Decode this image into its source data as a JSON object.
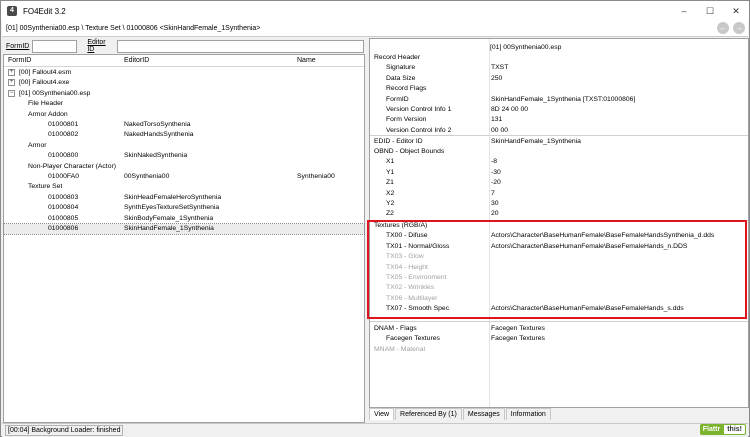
{
  "window": {
    "app_icon": "4",
    "title": "FO4Edit 3.2",
    "minimize": "–",
    "maximize": "☐",
    "close": "✕"
  },
  "path": {
    "text": "[01] 00Synthenia00.esp \\ Texture Set \\ 01000806 <SkinHandFemale_1Synthenia>",
    "back_icon": "←",
    "forward_icon": "→"
  },
  "filter": {
    "formid_label": "FormID",
    "editorid_label": "Editor ID",
    "formid_value": "",
    "editorid_value": ""
  },
  "tree": {
    "columns": [
      "FormID",
      "EditorID",
      "Name"
    ],
    "rows": [
      {
        "exp": "+",
        "formid": "[00] Fallout4.esm",
        "editorid": "",
        "name": ""
      },
      {
        "exp": "+",
        "formid": "[00] Fallout4.exe",
        "editorid": "",
        "name": ""
      },
      {
        "exp": "−",
        "formid": "[01] 00Synthenia00.esp",
        "editorid": "",
        "name": ""
      },
      {
        "exp": "",
        "formid": "File Header",
        "editorid": "",
        "name": ""
      },
      {
        "exp": "",
        "formid": "Armor Addon",
        "editorid": "",
        "name": ""
      },
      {
        "exp": "",
        "formid": "01000801",
        "editorid": "NakedTorsoSynthenia",
        "name": ""
      },
      {
        "exp": "",
        "formid": "01000802",
        "editorid": "NakedHandsSynthenia",
        "name": ""
      },
      {
        "exp": "",
        "formid": "Armor",
        "editorid": "",
        "name": ""
      },
      {
        "exp": "",
        "formid": "01000800",
        "editorid": "SkinNakedSynthenia",
        "name": ""
      },
      {
        "exp": "",
        "formid": "Non-Player Character (Actor)",
        "editorid": "",
        "name": ""
      },
      {
        "exp": "",
        "formid": "01000FA0",
        "editorid": "00Synthenia00",
        "name": "Synthenia00"
      },
      {
        "exp": "",
        "formid": "Texture Set",
        "editorid": "",
        "name": ""
      },
      {
        "exp": "",
        "formid": "01000803",
        "editorid": "SkinHeadFemaleHeroSynthenia",
        "name": ""
      },
      {
        "exp": "",
        "formid": "01000804",
        "editorid": "SynthEyesTextureSetSynthenia",
        "name": ""
      },
      {
        "exp": "",
        "formid": "01000805",
        "editorid": "SkinBodyFemale_1Synthenia",
        "name": ""
      },
      {
        "exp": "",
        "formid": "01000806",
        "editorid": "SkinHandFemale_1Synthenia",
        "name": ""
      }
    ]
  },
  "record": {
    "header": "[01] 00Synthenia00.esp",
    "rows": [
      {
        "label": "Record Header",
        "value": ""
      },
      {
        "label": "Signature",
        "value": "TXST"
      },
      {
        "label": "Data Size",
        "value": "250"
      },
      {
        "label": "Record Flags",
        "value": ""
      },
      {
        "label": "FormID",
        "value": "SkinHandFemale_1Synthenia [TXST:01000806]"
      },
      {
        "label": "Version Control Info 1",
        "value": "8D 24 00 00"
      },
      {
        "label": "Form Version",
        "value": "131"
      },
      {
        "label": "Version Control Info 2",
        "value": "00 00"
      },
      {
        "label": "EDID - Editor ID",
        "value": "SkinHandFemale_1Synthenia"
      },
      {
        "label": "OBND - Object Bounds",
        "value": ""
      },
      {
        "label": "X1",
        "value": "-8"
      },
      {
        "label": "Y1",
        "value": "-30"
      },
      {
        "label": "Z1",
        "value": "-20"
      },
      {
        "label": "X2",
        "value": "7"
      },
      {
        "label": "Y2",
        "value": "30"
      },
      {
        "label": "Z2",
        "value": "20"
      },
      {
        "label": "Textures (RGB/A)",
        "value": ""
      },
      {
        "label": "TX00 - Difuse",
        "value": "Actors\\Character\\BaseHumanFemale\\BaseFemaleHandsSynthenia_d.dds"
      },
      {
        "label": "TX01 - Normal/Gloss",
        "value": "Actors\\Character\\BaseHumanFemale\\BaseFemaleHands_n.DDS"
      },
      {
        "label": "TX03 - Glow",
        "value": ""
      },
      {
        "label": "TX04 - Height",
        "value": ""
      },
      {
        "label": "TX05 - Environment",
        "value": ""
      },
      {
        "label": "TX02 - Wrinkles",
        "value": ""
      },
      {
        "label": "TX06 - Multilayer",
        "value": ""
      },
      {
        "label": "TX07 - Smooth Spec",
        "value": "Actors\\Character\\BaseHumanFemale\\BaseFemaleHands_s.dds"
      },
      {
        "label": "DNAM - Flags",
        "value": "Facegen Textures"
      },
      {
        "label": "Facegen Textures",
        "value": "Facegen Textures"
      },
      {
        "label": "MNAM - Material",
        "value": ""
      }
    ]
  },
  "tabs": [
    "View",
    "Referenced By (1)",
    "Messages",
    "Information"
  ],
  "status": {
    "text": "[00:04] Background Loader: finished"
  },
  "flattr": {
    "left": "Flattr",
    "right": "this!"
  },
  "colors": {
    "highlight": "#e0141e",
    "flattr": "#7bb32e"
  }
}
